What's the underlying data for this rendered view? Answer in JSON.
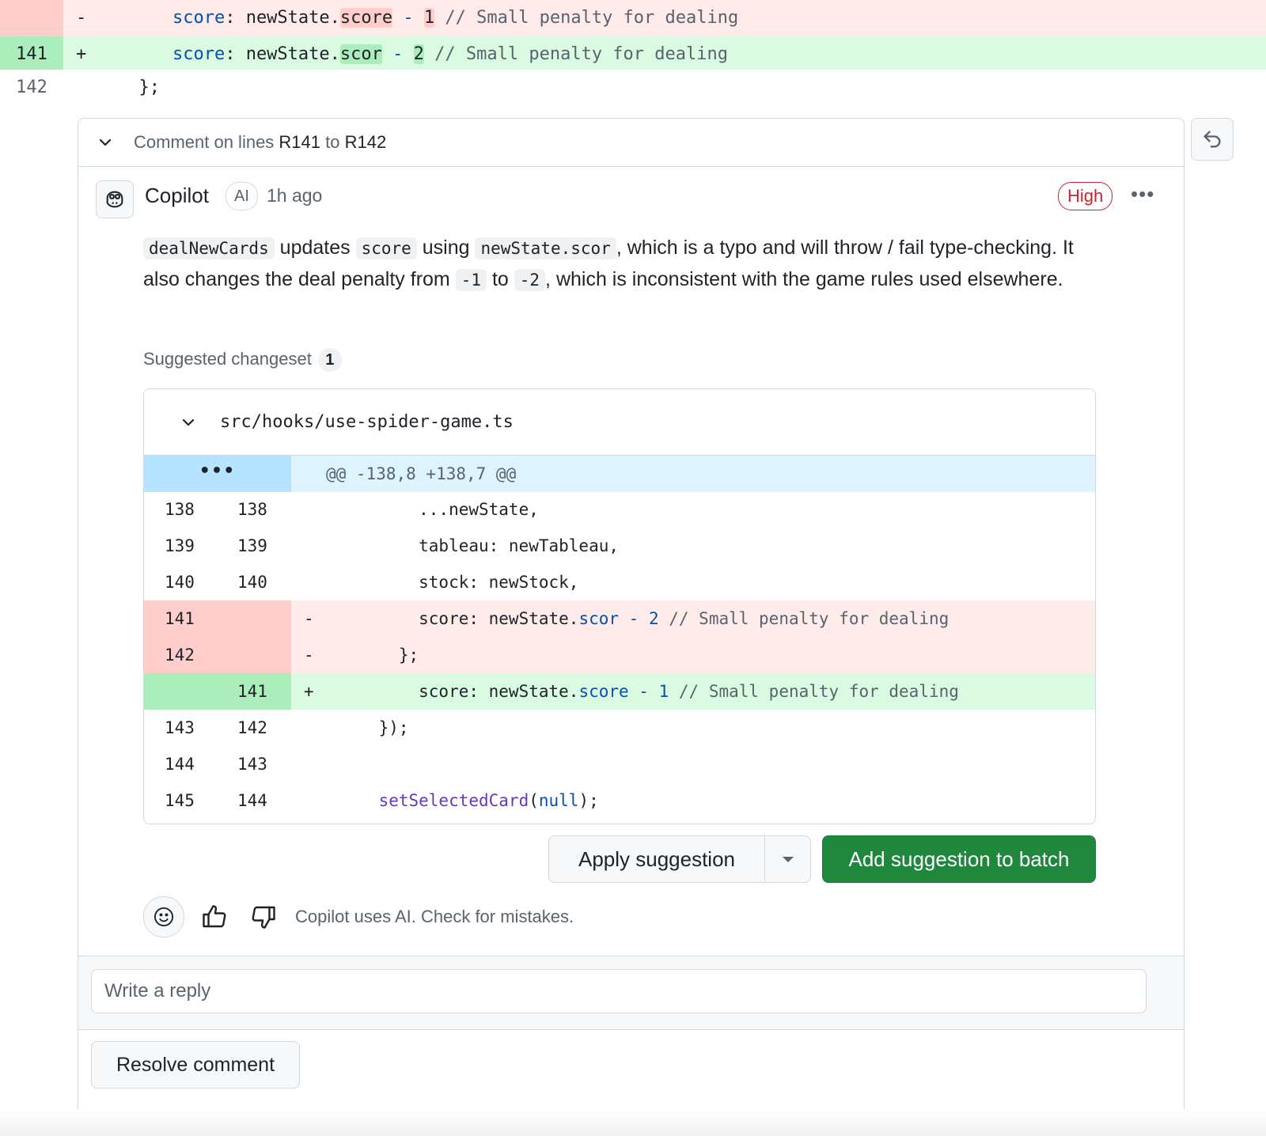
{
  "top_diff": {
    "rows": [
      {
        "type": "del",
        "line": "",
        "sign": "-",
        "indent": "        ",
        "key": "score",
        "sep": ": newState.",
        "prop": "score",
        "op": " - ",
        "num": "1",
        "comment": " // Small penalty for dealing"
      },
      {
        "type": "add",
        "line": "141",
        "sign": "+",
        "indent": "        ",
        "key": "score",
        "sep": ": newState.",
        "prop": "scor",
        "op": " - ",
        "num": "2",
        "comment": " // Small penalty for dealing"
      },
      {
        "type": "plain",
        "line": "142",
        "sign": "",
        "code": "      };"
      }
    ]
  },
  "comment": {
    "header_prefix": "Comment on lines ",
    "range_start": "R141",
    "range_mid": " to ",
    "range_end": "R142",
    "author": "Copilot",
    "ai_badge": "AI",
    "time": "1h ago",
    "severity": "High",
    "more_label": "•••",
    "body": {
      "p1_code1": "dealNewCards",
      "p1_t1": " updates ",
      "p1_code2": "score",
      "p1_t2": " using ",
      "p1_code3": "newState.scor",
      "p1_t3": ", which is a typo and will throw / fail type-checking. It also changes the deal penalty from ",
      "p1_code4": "-1",
      "p1_t4": " to ",
      "p1_code5": "-2",
      "p1_t5": ", which is inconsistent with the game rules used elsewhere."
    },
    "changeset_label": "Suggested changeset",
    "changeset_count": "1"
  },
  "suggestion": {
    "file_path": "src/hooks/use-spider-game.ts",
    "expander": "•••",
    "hunk_header": "@@ -138,8 +138,7 @@",
    "rows": [
      {
        "type": "ctx",
        "n1": "138",
        "n2": "138",
        "sign": "",
        "code": "        ...newState,"
      },
      {
        "type": "ctx",
        "n1": "139",
        "n2": "139",
        "sign": "",
        "code": "        tableau: newTableau,"
      },
      {
        "type": "ctx",
        "n1": "140",
        "n2": "140",
        "sign": "",
        "code": "        stock: newStock,"
      },
      {
        "type": "del",
        "n1": "141",
        "n2": "",
        "sign": "-",
        "pre": "        score: newState.",
        "prop": "scor",
        "op": " - ",
        "num": "2",
        "comment": " // Small penalty for dealing"
      },
      {
        "type": "del",
        "n1": "142",
        "n2": "",
        "sign": "-",
        "code": "      };"
      },
      {
        "type": "add",
        "n1": "",
        "n2": "141",
        "sign": "+",
        "pre": "        score: newState.",
        "prop": "score",
        "op": " - ",
        "num": "1",
        "comment": " // Small penalty for dealing"
      },
      {
        "type": "ctx",
        "n1": "143",
        "n2": "142",
        "sign": "",
        "code": "    });"
      },
      {
        "type": "ctx",
        "n1": "144",
        "n2": "143",
        "sign": "",
        "code": ""
      },
      {
        "type": "ctx",
        "n1": "145",
        "n2": "144",
        "sign": "",
        "fn": "    setSelectedCard",
        "paren1": "(",
        "lit": "null",
        "paren2": ");"
      }
    ]
  },
  "actions": {
    "apply_label": "Apply suggestion",
    "batch_label": "Add suggestion to batch",
    "disclaimer": "Copilot uses AI. Check for mistakes."
  },
  "reply": {
    "placeholder": "Write a reply",
    "resolve_label": "Resolve comment"
  },
  "colors": {
    "accent_green": "#1f883d",
    "severity_red": "#cf222e",
    "del_bg": "#ffebe9",
    "add_bg": "#dafbe1",
    "hunk_bg": "#ddf4ff"
  }
}
